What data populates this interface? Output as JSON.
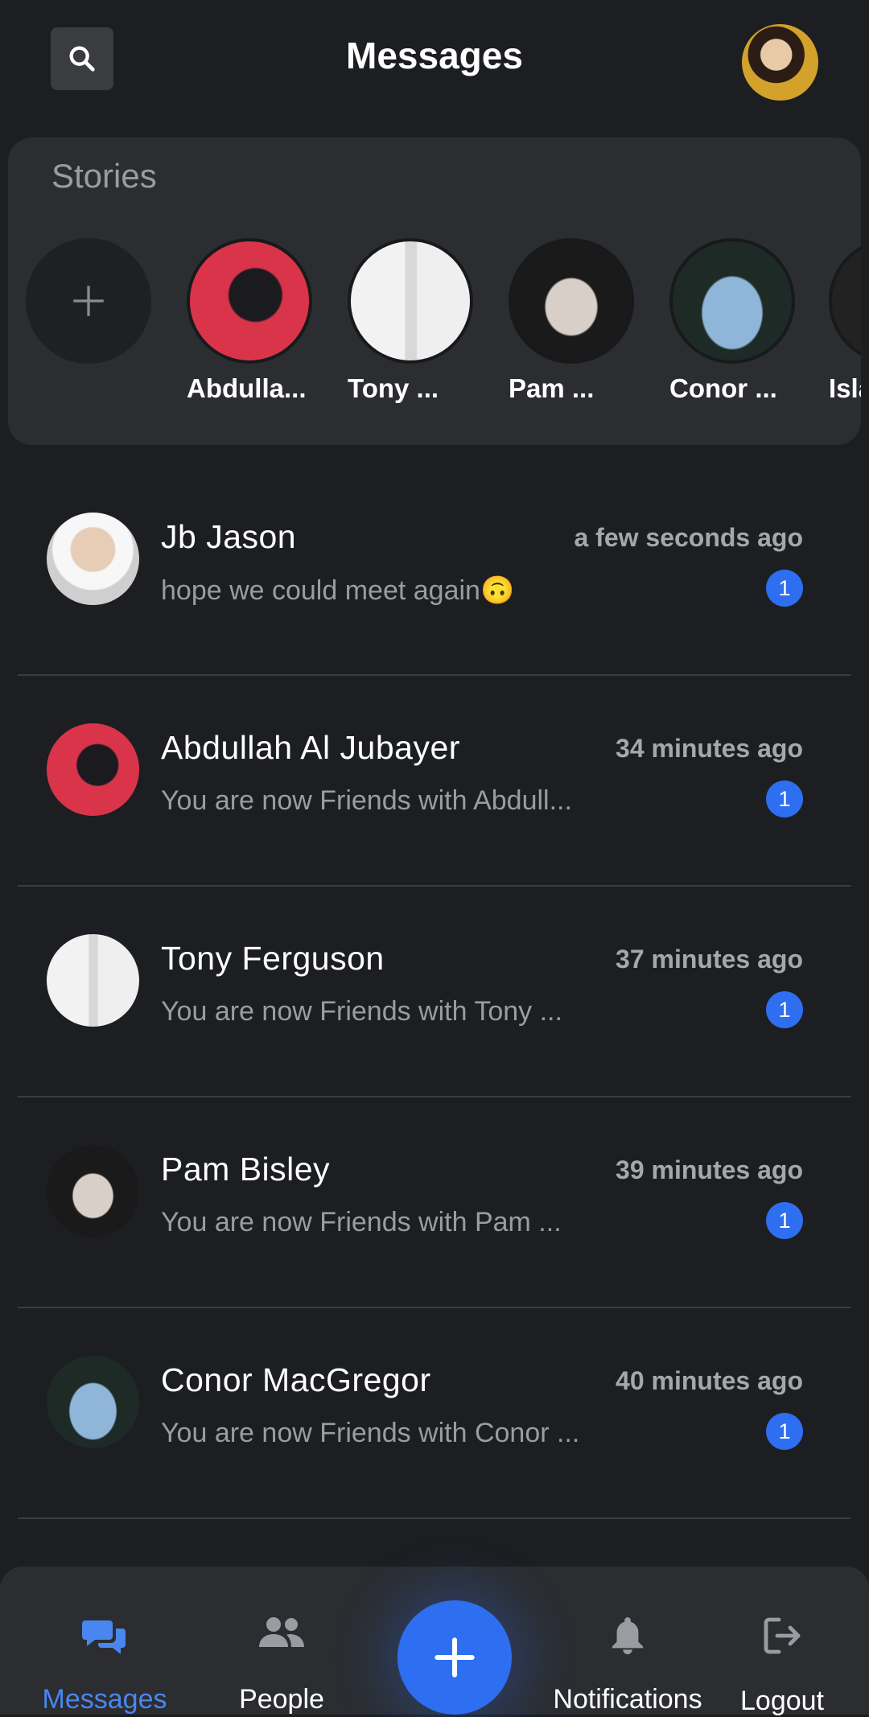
{
  "header": {
    "title": "Messages",
    "search_icon": "search-icon",
    "profile_avatar": "profile-avatar"
  },
  "stories": {
    "title": "Stories",
    "add_icon": "plus-icon",
    "items": [
      {
        "name": "Abdulla..."
      },
      {
        "name": "Tony ..."
      },
      {
        "name": "Pam ..."
      },
      {
        "name": "Conor ..."
      },
      {
        "name": "Isla"
      }
    ]
  },
  "conversations": [
    {
      "name": "Jb Jason",
      "message": "hope we could meet again🙃",
      "time": "a few seconds ago",
      "unread": "1"
    },
    {
      "name": "Abdullah Al Jubayer",
      "message": "You are now Friends with Abdull...",
      "time": "34 minutes ago",
      "unread": "1"
    },
    {
      "name": "Tony Ferguson",
      "message": "You are now Friends with Tony ...",
      "time": "37 minutes ago",
      "unread": "1"
    },
    {
      "name": "Pam Bisley",
      "message": "You are now Friends with Pam ...",
      "time": "39 minutes ago",
      "unread": "1"
    },
    {
      "name": "Conor MacGregor",
      "message": "You are now Friends with Conor ...",
      "time": "40 minutes ago",
      "unread": "1"
    }
  ],
  "bottom_nav": {
    "messages": "Messages",
    "people": "People",
    "notifications": "Notifications",
    "logout": "Logout",
    "fab_icon": "plus-icon"
  },
  "colors": {
    "background": "#1c1e21",
    "panel": "#2b2d31",
    "accent": "#2e6ef0",
    "active_nav": "#4a86ef"
  }
}
